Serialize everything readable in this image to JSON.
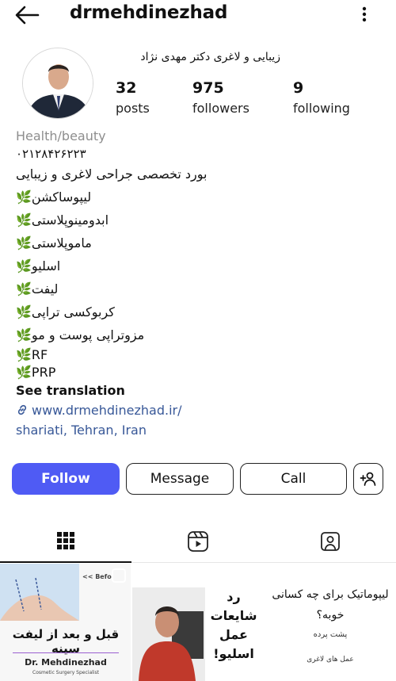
{
  "header": {
    "username": "drmehdinezhad"
  },
  "profile": {
    "full_name": "زیبایی و لاغری دکتر مهدی نژاد",
    "stats": {
      "posts": {
        "value": "32",
        "label": "posts"
      },
      "followers": {
        "value": "975",
        "label": "followers"
      },
      "following": {
        "value": "9",
        "label": "following"
      }
    }
  },
  "bio": {
    "category": "Health/beauty",
    "phone": "۰۲۱۲۸۴۲۶۲۲۳",
    "headline": "بورد تخصصی جراحی لاغری و زیبایی",
    "services": [
      "لیپوساکشن🌿",
      "ابدومینوپلاستی🌿",
      "ماموپلاستی🌿",
      "اسلیو🌿",
      "لیفت🌿",
      "کربوکسی تراپی🌿",
      "مزوتراپی پوست و مو🌿",
      "🌿RF",
      "🌿PRP"
    ],
    "see_translation": "See translation",
    "website": "www.drmehdinezhad.ir/",
    "location": "shariati, Tehran, Iran"
  },
  "actions": {
    "follow": "Follow",
    "message": "Message",
    "call": "Call"
  },
  "tabs": [
    {
      "icon": "grid-icon"
    },
    {
      "icon": "reels-icon"
    },
    {
      "icon": "tagged-icon"
    }
  ],
  "posts": [
    {
      "caption": "قبل و بعد از لیفت سینه",
      "before_label": "<< Befo",
      "name": "Dr. Mehdinezhad",
      "subtitle": "Cosmetic Surgery Specialist"
    },
    {
      "caption": "رد شایعات عمل اسلیو!"
    },
    {
      "title": "لیپوماتیک برای چه کسانی خوبه؟",
      "subtitle": "پشت پرده",
      "footer": "عمل های لاغری"
    }
  ],
  "colors": {
    "follow_button": "#4f5bf4",
    "link": "#385898",
    "category": "#8e8e8e"
  }
}
